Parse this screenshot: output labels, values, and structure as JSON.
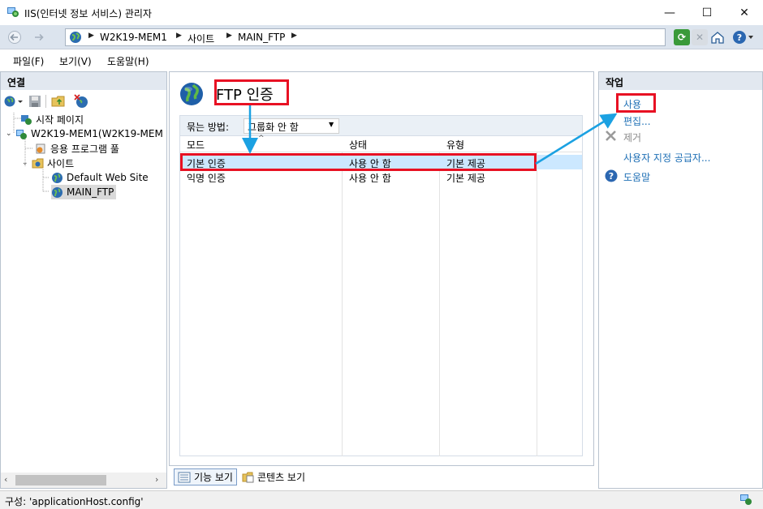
{
  "window": {
    "title": "IIS(인터넷 정보 서비스) 관리자",
    "controls": [
      "—",
      "☐",
      "✕"
    ]
  },
  "address_bar": {
    "crumbs": [
      "W2K19-MEM1",
      "사이트",
      "MAIN_FTP"
    ]
  },
  "menu": [
    "파일(F)",
    "보기(V)",
    "도움말(H)"
  ],
  "connections": {
    "header": "연결",
    "tree": [
      {
        "label": "시작 페이지",
        "depth": 0
      },
      {
        "label": "W2K19-MEM1(W2K19-MEM",
        "depth": 0
      },
      {
        "label": "응용 프로그램 풀",
        "depth": 1
      },
      {
        "label": "사이트",
        "depth": 1
      },
      {
        "label": "Default Web Site",
        "depth": 2
      },
      {
        "label": "MAIN_FTP",
        "depth": 2,
        "selected": true
      }
    ]
  },
  "feature": {
    "title": "FTP 인증",
    "group_by_label": "묶는 방법:",
    "group_by_value": "그룹화 안 함",
    "columns": [
      "모드",
      "상태",
      "유형"
    ],
    "rows": [
      {
        "mode": "기본 인증",
        "status": "사용 안 함",
        "type": "기본 제공",
        "selected": true
      },
      {
        "mode": "익명 인증",
        "status": "사용 안 함",
        "type": "기본 제공",
        "selected": false
      }
    ]
  },
  "view_tabs": [
    "기능 보기",
    "콘텐츠 보기"
  ],
  "actions": {
    "header": "작업",
    "items": [
      {
        "label": "사용",
        "enabled": true
      },
      {
        "label": "편집...",
        "enabled": true
      },
      {
        "label": "제거",
        "enabled": false
      },
      {
        "label": "사용자 지정 공급자...",
        "enabled": true
      },
      {
        "label": "도움말",
        "enabled": true
      }
    ]
  },
  "status": {
    "text": "구성: 'applicationHost.config'"
  },
  "colors": {
    "annotation_red": "#e81123",
    "annotation_arrow": "#1ba1e2",
    "link_blue": "#1e6fb5",
    "selection": "#cce8ff"
  }
}
